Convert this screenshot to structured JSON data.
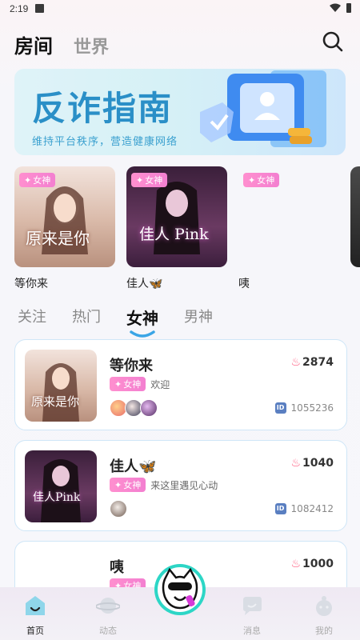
{
  "status": {
    "time": "2:19"
  },
  "top_tabs": [
    {
      "label": "房间"
    },
    {
      "label": "世界"
    }
  ],
  "banner": {
    "title": "反诈指南",
    "subtitle": "维持平台秩序，营造健康网络"
  },
  "tag_label": "女神",
  "featured": [
    {
      "name": "等你来",
      "thumb_text": "原来是你"
    },
    {
      "name": "佳人🦋",
      "thumb_text": "佳人 Pink"
    },
    {
      "name": "咦",
      "thumb_text": ""
    }
  ],
  "category_tabs": [
    {
      "label": "关注"
    },
    {
      "label": "热门"
    },
    {
      "label": "女神"
    },
    {
      "label": "男神"
    }
  ],
  "rooms": [
    {
      "name": "等你来",
      "heat": "2874",
      "notice": "欢迎",
      "id": "1055236",
      "thumb_text": "原来是你"
    },
    {
      "name": "佳人🦋",
      "heat": "1040",
      "notice": "来这里遇见心动",
      "id": "1082412",
      "thumb_text": "佳人Pink"
    },
    {
      "name": "咦",
      "heat": "1000",
      "notice": "",
      "id": "",
      "thumb_text": ""
    }
  ],
  "bottom_nav": [
    {
      "label": "首页",
      "icon": "home-icon"
    },
    {
      "label": "动态",
      "icon": "planet-icon"
    },
    {
      "label": "消息",
      "icon": "message-icon"
    },
    {
      "label": "我的",
      "icon": "profile-icon"
    }
  ],
  "colors": {
    "accent": "#2a8fc7",
    "tag": "#f37fd0",
    "heat": "#ff5b7f"
  }
}
